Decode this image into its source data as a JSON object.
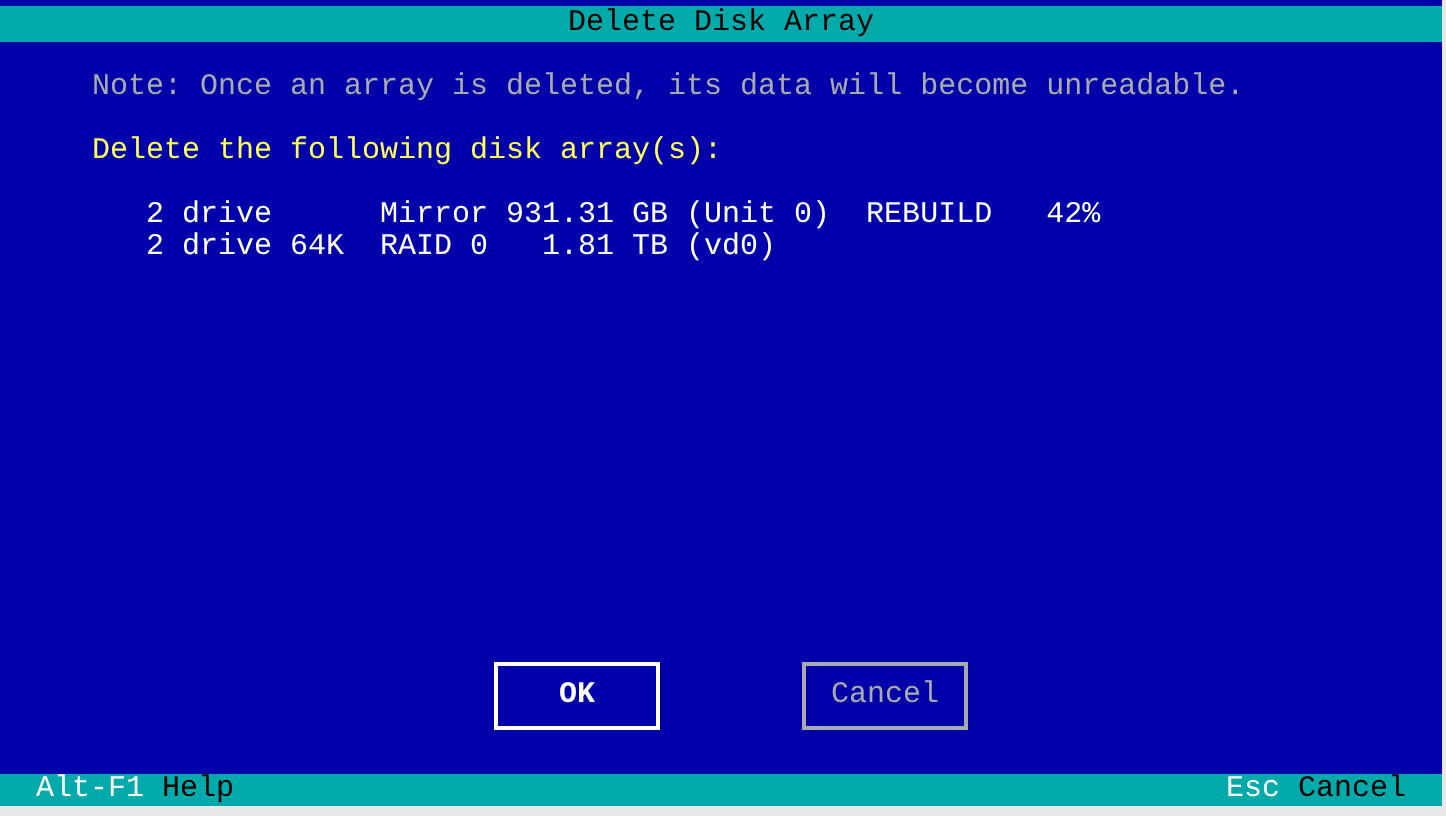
{
  "window": {
    "title": "Delete Disk Array"
  },
  "note": "Note: Once an array is deleted, its data will become unreadable.",
  "heading": "Delete the following disk array(s):",
  "arrays": [
    "2 drive      Mirror 931.31 GB (Unit 0)  REBUILD   42%",
    "2 drive 64K  RAID 0   1.81 TB (vd0)"
  ],
  "buttons": [
    {
      "label": "OK",
      "disabled": false
    },
    {
      "label": "Cancel",
      "disabled": true
    }
  ],
  "status_bar": {
    "left": {
      "key": "Alt-F1",
      "label": "Help"
    },
    "right": {
      "key": "Esc",
      "label": "Cancel"
    }
  }
}
